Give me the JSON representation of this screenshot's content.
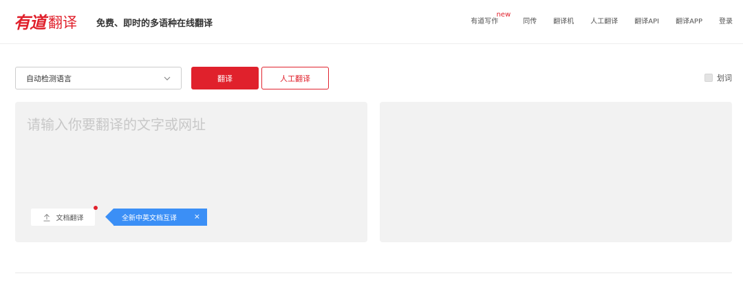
{
  "header": {
    "logo_brand": "有道",
    "logo_product": "翻译",
    "tagline": "免费、即时的多语种在线翻译",
    "nav": [
      {
        "label": "有道写作",
        "badge": "new"
      },
      {
        "label": "同传"
      },
      {
        "label": "翻译机"
      },
      {
        "label": "人工翻译"
      },
      {
        "label": "翻译API"
      },
      {
        "label": "翻译APP"
      },
      {
        "label": "登录"
      }
    ]
  },
  "toolbar": {
    "language_select": "自动检测语言",
    "translate_button": "翻译",
    "human_button": "人工翻译",
    "huaci_label": "划词"
  },
  "input_panel": {
    "placeholder": "请输入你要翻译的文字或网址",
    "doc_button": "文档翻译",
    "promo_text": "全新中英文档互译",
    "promo_close": "×"
  },
  "colors": {
    "brand_red": "#e0212c",
    "promo_blue": "#3b8ff6",
    "panel_bg": "#f2f2f2"
  }
}
